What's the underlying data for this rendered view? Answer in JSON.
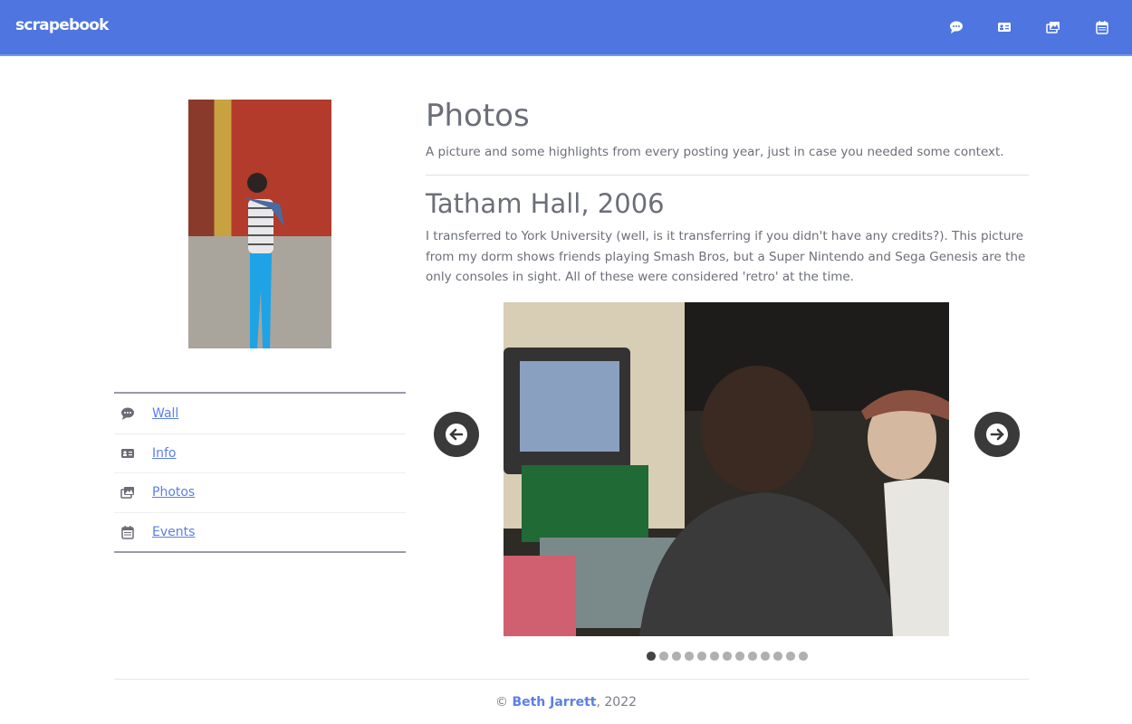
{
  "navbar": {
    "brand": "scrapebook",
    "icons": [
      "chat-icon",
      "id-card-icon",
      "photos-icon",
      "calendar-icon"
    ],
    "color": "#4e75e0"
  },
  "sidebar": {
    "items": [
      {
        "label": "Wall",
        "icon": "chat-icon"
      },
      {
        "label": "Info",
        "icon": "id-card-icon"
      },
      {
        "label": "Photos",
        "icon": "photos-icon"
      },
      {
        "label": "Events",
        "icon": "calendar-icon"
      }
    ]
  },
  "main": {
    "title": "Photos",
    "subtitle": "A picture and some highlights from every posting year, just in case you needed some context.",
    "entry_title": "Tatham Hall, 2006",
    "entry_text": "I transferred to York University (well, is it transferring if you didn't have any credits?). This picture from my dorm shows friends playing Smash Bros, but a Super Nintendo and Sega Genesis are the only consoles in sight. All of these were considered 'retro' at the time."
  },
  "carousel": {
    "slide_count": 13,
    "active_index": 0
  },
  "footer": {
    "copy": "©",
    "name": "Beth Jarrett",
    "year": ", 2022"
  }
}
